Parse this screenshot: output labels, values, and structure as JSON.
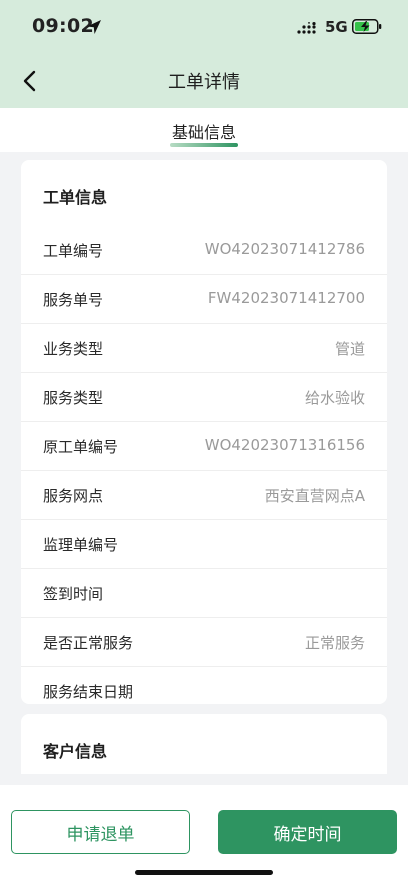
{
  "status_bar": {
    "time": "09:02",
    "network": "5G",
    "icons": [
      "location-arrow-icon",
      "signal-icon",
      "battery-charging-icon"
    ]
  },
  "nav": {
    "back_icon": "chevron-left-icon",
    "title": "工单详情"
  },
  "tabs": [
    {
      "label": "基础信息",
      "active": true
    }
  ],
  "order_card": {
    "title": "工单信息",
    "rows": [
      {
        "label": "工单编号",
        "value": "WO42023071412786"
      },
      {
        "label": "服务单号",
        "value": "FW42023071412700"
      },
      {
        "label": "业务类型",
        "value": "管道"
      },
      {
        "label": "服务类型",
        "value": "给水验收"
      },
      {
        "label": "原工单编号",
        "value": "WO42023071316156"
      },
      {
        "label": "服务网点",
        "value": "西安直营网点A"
      },
      {
        "label": "监理单编号",
        "value": ""
      },
      {
        "label": "签到时间",
        "value": ""
      },
      {
        "label": "是否正常服务",
        "value": "正常服务"
      },
      {
        "label": "服务结束日期",
        "value": ""
      }
    ]
  },
  "customer_card": {
    "title": "客户信息"
  },
  "bottom_bar": {
    "cancel_label": "申请退单",
    "confirm_label": "确定时间"
  },
  "colors": {
    "header_bg": "#d6ebdc",
    "accent": "#2e9461",
    "page_bg": "#f2f3f5",
    "value_text": "#9a9a9a"
  }
}
